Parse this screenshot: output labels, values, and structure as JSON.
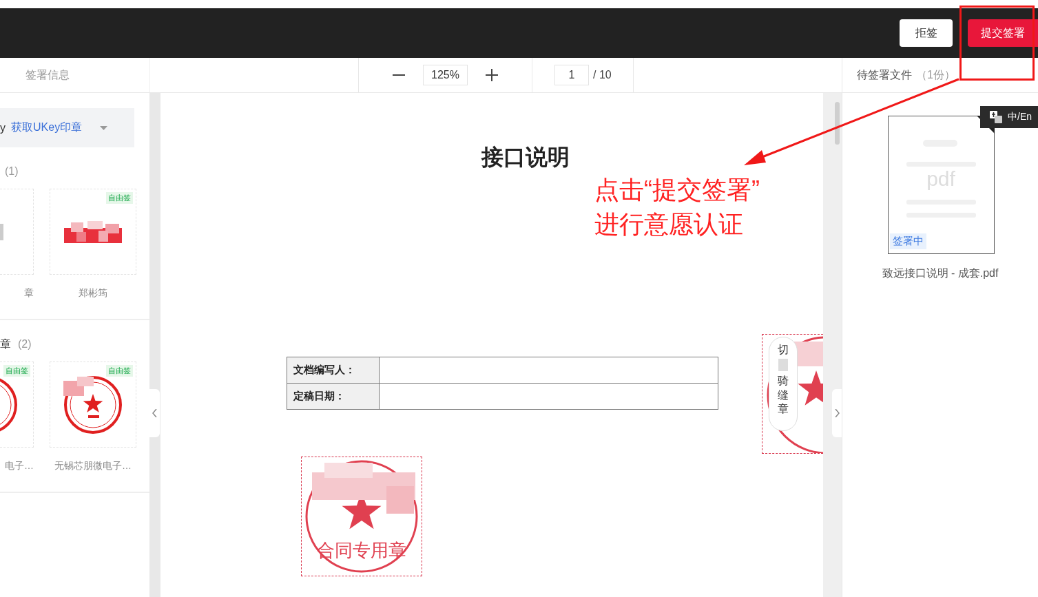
{
  "header": {
    "buttons": [
      {
        "label": "拒签",
        "kind": "secondary"
      },
      {
        "label": "提交签署",
        "kind": "primary"
      }
    ]
  },
  "left_panel": {
    "title": "签署信息",
    "ukey": {
      "prefix": "y",
      "link": "获取UKey印章"
    },
    "groups": [
      {
        "count": "(1)",
        "seals": [
          {
            "kind": "glyph",
            "name": "章"
          },
          {
            "kind": "signature",
            "tag": "自由签",
            "name": "郑彬筠"
          }
        ]
      },
      {
        "title": "章",
        "count": "(2)",
        "seals": [
          {
            "kind": "round",
            "tag": "自由签",
            "name": "电子…"
          },
          {
            "kind": "round",
            "tag": "自由签",
            "name": "无锡芯朋微电子…"
          }
        ]
      }
    ]
  },
  "toolbar": {
    "zoom": "125%",
    "page": "1",
    "total": "/ 10"
  },
  "document": {
    "title": "接口说明",
    "table": [
      {
        "label": "文档编写人："
      },
      {
        "label": "定稿日期："
      }
    ],
    "stamp": {
      "text": "合同专用章"
    },
    "seam": {
      "label_top": "切",
      "label_bottom": "骑缝章"
    }
  },
  "annotation": {
    "lines": [
      "点击“提交签署”",
      "进行意愿认证"
    ]
  },
  "right_panel": {
    "title": "待签署文件",
    "count": "（1份）",
    "files": [
      {
        "name": "致远接口说明 - 成套.pdf",
        "thumb": "pdf",
        "status": "签署中",
        "selected": true
      }
    ],
    "language": "中/En"
  }
}
